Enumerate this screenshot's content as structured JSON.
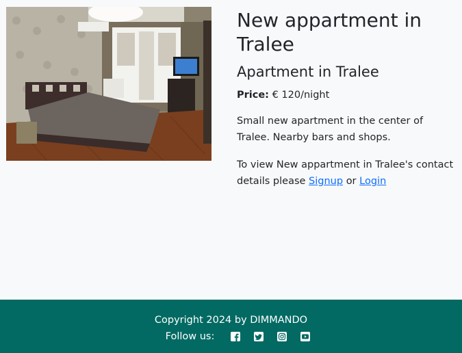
{
  "listing": {
    "title": "New appartment in Tralee",
    "subtitle": "Apartment in Tralee",
    "price_label": "Price:",
    "price_value": "€ 120/night",
    "description": "Small new apartment in the center of Tralee. Nearby bars and shops.",
    "contact_prefix": "To view New appartment in Tralee's contact details please",
    "signup_label": "Signup",
    "or_text": "or",
    "login_label": "Login",
    "photo_icon": "bedroom-photo"
  },
  "footer": {
    "copyright": "Copyright 2024 by DIMMANDO",
    "follow_label": "Follow us:",
    "social_icons": [
      "facebook-icon",
      "twitter-icon",
      "instagram-icon",
      "youtube-icon"
    ],
    "background_color": "#026a63"
  },
  "colors": {
    "link": "#0d6efd",
    "page_background": "#f8f9fa",
    "footer_background": "#026a63"
  }
}
